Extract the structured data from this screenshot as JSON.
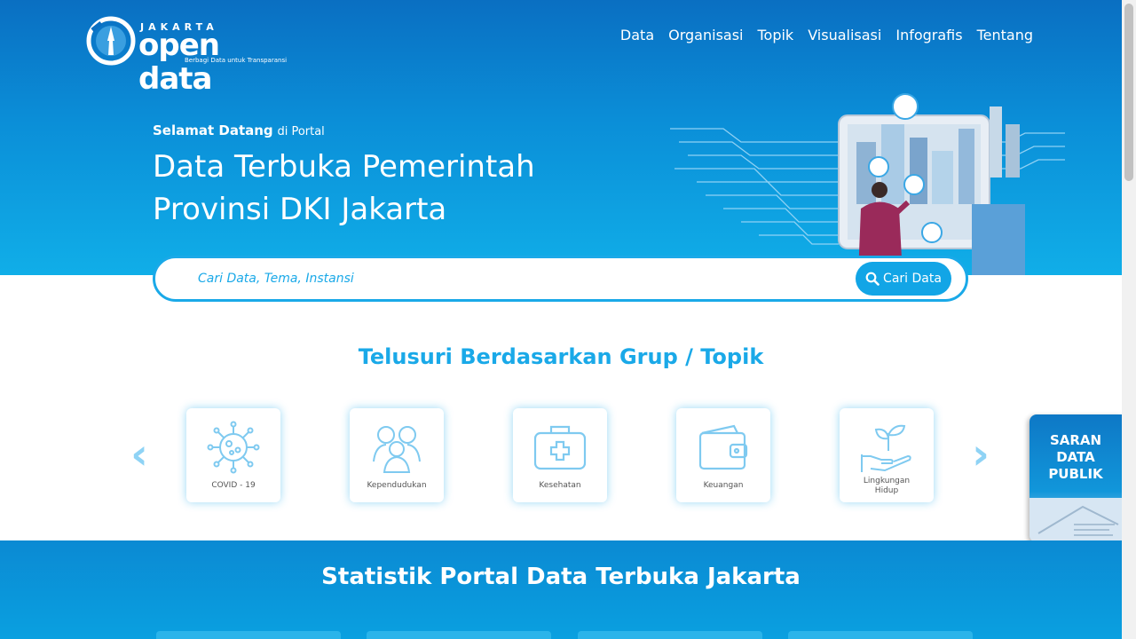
{
  "logo": {
    "top": "JAKARTA",
    "main": "open data",
    "tagline": "Berbagi Data untuk Transparansi"
  },
  "nav": {
    "items": [
      "Data",
      "Organisasi",
      "Topik",
      "Visualisasi",
      "Infografis",
      "Tentang"
    ]
  },
  "hero": {
    "welcome_bold": "Selamat Datang",
    "welcome_rest": "di Portal",
    "headline_line1": "Data Terbuka Pemerintah",
    "headline_line2": "Provinsi DKI Jakarta"
  },
  "search": {
    "placeholder": "Cari Data, Tema, Instansi",
    "button_label": "Cari Data"
  },
  "topics": {
    "title": "Telusuri Berdasarkan Grup / Topik",
    "items": [
      {
        "label": "COVID - 19",
        "icon": "virus-icon"
      },
      {
        "label": "Kependudukan",
        "icon": "people-icon"
      },
      {
        "label": "Kesehatan",
        "icon": "first-aid-kit-icon"
      },
      {
        "label": "Keuangan",
        "icon": "wallet-icon"
      },
      {
        "label": "Lingkungan Hidup",
        "icon": "plant-hand-icon"
      }
    ],
    "prev_icon": "chevron-left-icon",
    "next_icon": "chevron-right-icon"
  },
  "saran": {
    "label": "SARAN DATA PUBLIK"
  },
  "stats": {
    "title": "Statistik Portal Data Terbuka Jakarta"
  },
  "colors": {
    "primary": "#1aa9e8",
    "hero_dark": "#0a6fc2",
    "white": "#ffffff"
  }
}
